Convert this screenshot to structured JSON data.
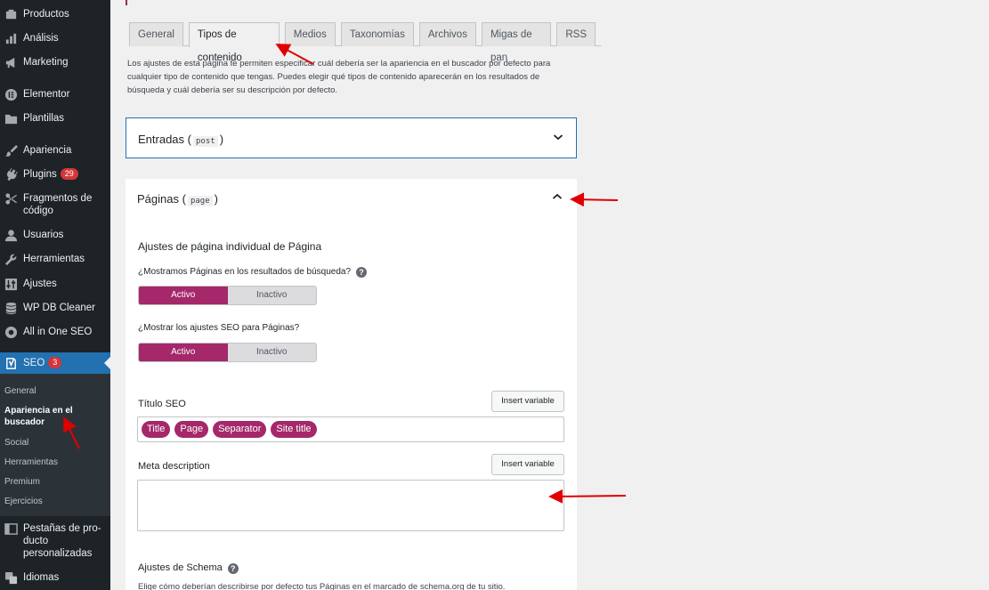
{
  "sidebar": {
    "items": [
      {
        "label": "Productos",
        "icon": "products-icon"
      },
      {
        "label": "Análisis",
        "icon": "analytics-icon"
      },
      {
        "label": "Marketing",
        "icon": "megaphone-icon"
      },
      {
        "label": "Elementor",
        "icon": "elementor-icon"
      },
      {
        "label": "Plantillas",
        "icon": "folder-icon"
      },
      {
        "label": "Apariencia",
        "icon": "paintbrush-icon"
      },
      {
        "label": "Plugins",
        "icon": "plugin-icon",
        "badge": "29"
      },
      {
        "label": "Fragmentos de código",
        "icon": "scissors-icon"
      },
      {
        "label": "Usuarios",
        "icon": "user-icon"
      },
      {
        "label": "Herramientas",
        "icon": "wrench-icon"
      },
      {
        "label": "Ajustes",
        "icon": "settings-icon"
      },
      {
        "label": "WP DB Cleaner",
        "icon": "database-icon"
      },
      {
        "label": "All in One SEO",
        "icon": "aioseo-icon"
      }
    ],
    "seo": {
      "label": "SEO",
      "badge": "3",
      "icon": "yoast-icon"
    },
    "submenu": [
      "General",
      "Apariencia en el buscador",
      "Social",
      "Herramientas",
      "Premium",
      "Ejercicios"
    ],
    "after": [
      {
        "label": "Pestañas de pro-ducto personalizadas",
        "icon": "tabs-icon"
      },
      {
        "label": "Idiomas",
        "icon": "translate-icon"
      }
    ]
  },
  "tabs": [
    "General",
    "Tipos de contenido",
    "Medios",
    "Taxonomías",
    "Archivos",
    "Migas de pan",
    "RSS"
  ],
  "intro": "Los ajustes de esta página te permiten especificar cuál debería ser la apariencia en el buscador por defecto para cualquier tipo de contenido que tengas. Puedes elegir qué tipos de contenido aparecerán en los resultados de búsqueda y cuál debería ser su descripción por defecto.",
  "entradas": {
    "title": "Entradas",
    "slug": "post"
  },
  "paginas": {
    "title": "Páginas",
    "slug": "page",
    "section": "Ajustes de página individual de Página",
    "q1": "¿Mostramos Páginas en los resultados de búsqueda?",
    "q2": "¿Mostrar los ajustes SEO para Páginas?",
    "on": "Activo",
    "off": "Inactivo",
    "seo_title_label": "Título SEO",
    "insert_variable": "Insert variable",
    "pills": [
      "Title",
      "Page",
      "Separator",
      "Site title"
    ],
    "meta_label": "Meta description",
    "schema_label": "Ajustes de Schema",
    "schema_desc": "Elige cómo deberían describirse por defecto tus Páginas en el marcado de schema.org de tu sitio."
  },
  "colors": {
    "accent": "#a4286a",
    "wp_blue": "#2271b1",
    "annotation": "#e00000"
  }
}
